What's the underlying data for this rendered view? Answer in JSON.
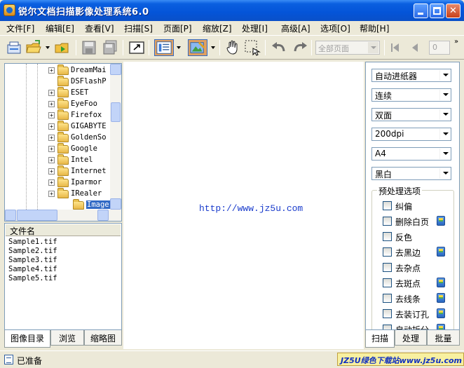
{
  "window": {
    "title": "锐尔文档扫描影像处理系统6.0"
  },
  "menu": [
    {
      "label": "文件[F]"
    },
    {
      "label": "编辑[E]"
    },
    {
      "label": "查看[V]"
    },
    {
      "label": "扫描[S]"
    },
    {
      "label": "页面[P]"
    },
    {
      "label": "缩放[Z]"
    },
    {
      "label": "处理[I]"
    },
    {
      "label": "高级[A]"
    },
    {
      "label": "选项[O]"
    },
    {
      "label": "帮助[H]"
    }
  ],
  "toolbar": {
    "page_combo": "全部页面",
    "page_number": "0"
  },
  "tree": {
    "items": [
      {
        "label": "DreamMai",
        "expandable": true
      },
      {
        "label": "DSFlashP",
        "expandable": false
      },
      {
        "label": "ESET",
        "expandable": true
      },
      {
        "label": "EyeFoo",
        "expandable": true
      },
      {
        "label": "Firefox",
        "expandable": true
      },
      {
        "label": "GIGABYTE",
        "expandable": true
      },
      {
        "label": "GoldenSo",
        "expandable": true
      },
      {
        "label": "Google",
        "expandable": true
      },
      {
        "label": "Intel",
        "expandable": true
      },
      {
        "label": "Internet",
        "expandable": true
      },
      {
        "label": "Iparmor",
        "expandable": true
      },
      {
        "label": "IRealer",
        "expandable": true
      },
      {
        "label": "Image",
        "expandable": false,
        "selected": true
      }
    ]
  },
  "filelist": {
    "header": "文件名",
    "files": [
      "Sample1.tif",
      "Sample2.tif",
      "Sample3.tif",
      "Sample4.tif",
      "Sample5.tif"
    ]
  },
  "left_tabs": [
    {
      "label": "图像目录",
      "active": true
    },
    {
      "label": "浏览",
      "active": false
    },
    {
      "label": "缩略图",
      "active": false
    }
  ],
  "canvas": {
    "url": "http://www.jz5u.com"
  },
  "scan_settings": {
    "source": "自动进纸器",
    "mode": "连续",
    "sides": "双面",
    "resolution": "200dpi",
    "paper": "A4",
    "color": "黑白"
  },
  "preprocess": {
    "title": "预处理选项",
    "options": [
      {
        "label": "纠偏",
        "has_settings": false
      },
      {
        "label": "删除白页",
        "has_settings": true
      },
      {
        "label": "反色",
        "has_settings": false
      },
      {
        "label": "去黑边",
        "has_settings": true
      },
      {
        "label": "去杂点",
        "has_settings": false
      },
      {
        "label": "去斑点",
        "has_settings": true
      },
      {
        "label": "去线条",
        "has_settings": true
      },
      {
        "label": "去装订孔",
        "has_settings": true
      },
      {
        "label": "自动拆分",
        "has_settings": true
      }
    ]
  },
  "right_tabs": [
    {
      "label": "扫描",
      "active": true
    },
    {
      "label": "处理",
      "active": false
    },
    {
      "label": "批量",
      "active": false
    }
  ],
  "status": {
    "text": "已准备",
    "watermark": "JZ5U绿色下载站www.jz5u.com"
  },
  "colors": {
    "title_blue": "#0454d8",
    "link_blue": "#1a3ccc",
    "selection": "#316ac5"
  }
}
